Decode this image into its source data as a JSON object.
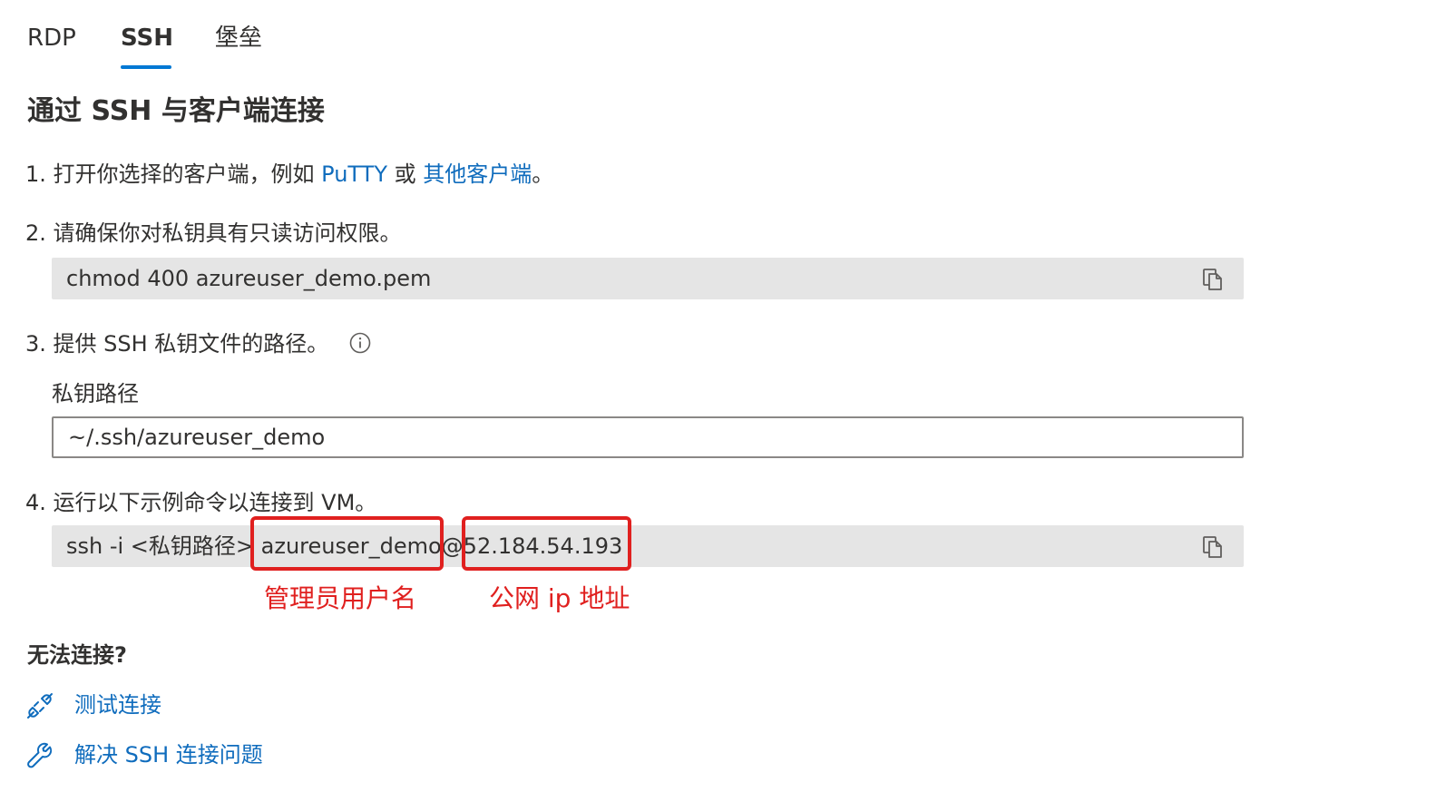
{
  "tabs": [
    {
      "label": "RDP"
    },
    {
      "label": "SSH"
    },
    {
      "label": "堡垒"
    }
  ],
  "heading": "通过 SSH 与客户端连接",
  "step1": {
    "prefix": "1. 打开你选择的客户端，例如 ",
    "putty_link": "PuTTY",
    "middle": " 或 ",
    "other_link": "其他客户端",
    "suffix": "。"
  },
  "step2": {
    "text": "2. 请确保你对私钥具有只读访问权限。",
    "command": "chmod 400 azureuser_demo.pem"
  },
  "step3": {
    "text": "3. 提供 SSH 私钥文件的路径。",
    "field_label": "私钥路径",
    "field_value": "~/.ssh/azureuser_demo"
  },
  "step4": {
    "text": "4. 运行以下示例命令以连接到 VM。",
    "command": "ssh -i <私钥路径> azureuser_demo@52.184.54.193"
  },
  "annotations": {
    "admin_username": "管理员用户名",
    "public_ip": "公网 ip 地址"
  },
  "troubleshoot": {
    "heading": "无法连接?",
    "test_connection": "测试连接",
    "fix_ssh": "解决 SSH 连接问题"
  },
  "colors": {
    "accent": "#0078d4",
    "link": "#0f6cbd",
    "annotation": "#e0201f",
    "code_bg": "#e5e5e5"
  }
}
